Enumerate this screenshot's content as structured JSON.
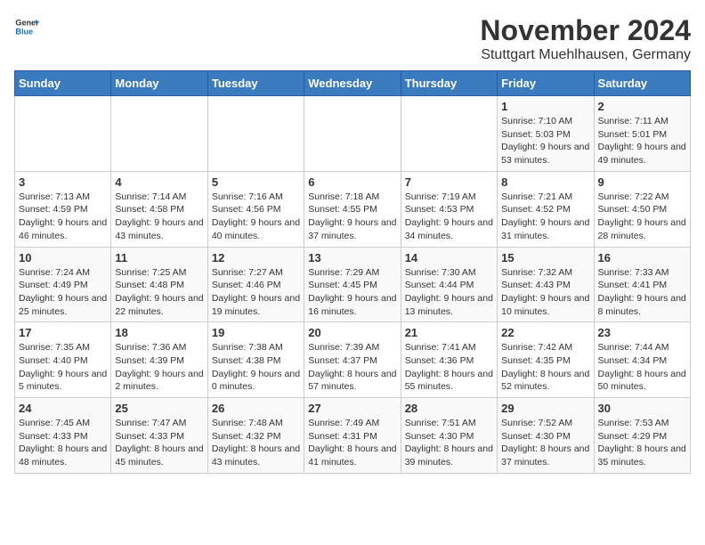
{
  "header": {
    "logo_general": "General",
    "logo_blue": "Blue",
    "month": "November 2024",
    "location": "Stuttgart Muehlhausen, Germany"
  },
  "days_of_week": [
    "Sunday",
    "Monday",
    "Tuesday",
    "Wednesday",
    "Thursday",
    "Friday",
    "Saturday"
  ],
  "weeks": [
    [
      {
        "day": "",
        "info": ""
      },
      {
        "day": "",
        "info": ""
      },
      {
        "day": "",
        "info": ""
      },
      {
        "day": "",
        "info": ""
      },
      {
        "day": "",
        "info": ""
      },
      {
        "day": "1",
        "info": "Sunrise: 7:10 AM\nSunset: 5:03 PM\nDaylight: 9 hours and 53 minutes."
      },
      {
        "day": "2",
        "info": "Sunrise: 7:11 AM\nSunset: 5:01 PM\nDaylight: 9 hours and 49 minutes."
      }
    ],
    [
      {
        "day": "3",
        "info": "Sunrise: 7:13 AM\nSunset: 4:59 PM\nDaylight: 9 hours and 46 minutes."
      },
      {
        "day": "4",
        "info": "Sunrise: 7:14 AM\nSunset: 4:58 PM\nDaylight: 9 hours and 43 minutes."
      },
      {
        "day": "5",
        "info": "Sunrise: 7:16 AM\nSunset: 4:56 PM\nDaylight: 9 hours and 40 minutes."
      },
      {
        "day": "6",
        "info": "Sunrise: 7:18 AM\nSunset: 4:55 PM\nDaylight: 9 hours and 37 minutes."
      },
      {
        "day": "7",
        "info": "Sunrise: 7:19 AM\nSunset: 4:53 PM\nDaylight: 9 hours and 34 minutes."
      },
      {
        "day": "8",
        "info": "Sunrise: 7:21 AM\nSunset: 4:52 PM\nDaylight: 9 hours and 31 minutes."
      },
      {
        "day": "9",
        "info": "Sunrise: 7:22 AM\nSunset: 4:50 PM\nDaylight: 9 hours and 28 minutes."
      }
    ],
    [
      {
        "day": "10",
        "info": "Sunrise: 7:24 AM\nSunset: 4:49 PM\nDaylight: 9 hours and 25 minutes."
      },
      {
        "day": "11",
        "info": "Sunrise: 7:25 AM\nSunset: 4:48 PM\nDaylight: 9 hours and 22 minutes."
      },
      {
        "day": "12",
        "info": "Sunrise: 7:27 AM\nSunset: 4:46 PM\nDaylight: 9 hours and 19 minutes."
      },
      {
        "day": "13",
        "info": "Sunrise: 7:29 AM\nSunset: 4:45 PM\nDaylight: 9 hours and 16 minutes."
      },
      {
        "day": "14",
        "info": "Sunrise: 7:30 AM\nSunset: 4:44 PM\nDaylight: 9 hours and 13 minutes."
      },
      {
        "day": "15",
        "info": "Sunrise: 7:32 AM\nSunset: 4:43 PM\nDaylight: 9 hours and 10 minutes."
      },
      {
        "day": "16",
        "info": "Sunrise: 7:33 AM\nSunset: 4:41 PM\nDaylight: 9 hours and 8 minutes."
      }
    ],
    [
      {
        "day": "17",
        "info": "Sunrise: 7:35 AM\nSunset: 4:40 PM\nDaylight: 9 hours and 5 minutes."
      },
      {
        "day": "18",
        "info": "Sunrise: 7:36 AM\nSunset: 4:39 PM\nDaylight: 9 hours and 2 minutes."
      },
      {
        "day": "19",
        "info": "Sunrise: 7:38 AM\nSunset: 4:38 PM\nDaylight: 9 hours and 0 minutes."
      },
      {
        "day": "20",
        "info": "Sunrise: 7:39 AM\nSunset: 4:37 PM\nDaylight: 8 hours and 57 minutes."
      },
      {
        "day": "21",
        "info": "Sunrise: 7:41 AM\nSunset: 4:36 PM\nDaylight: 8 hours and 55 minutes."
      },
      {
        "day": "22",
        "info": "Sunrise: 7:42 AM\nSunset: 4:35 PM\nDaylight: 8 hours and 52 minutes."
      },
      {
        "day": "23",
        "info": "Sunrise: 7:44 AM\nSunset: 4:34 PM\nDaylight: 8 hours and 50 minutes."
      }
    ],
    [
      {
        "day": "24",
        "info": "Sunrise: 7:45 AM\nSunset: 4:33 PM\nDaylight: 8 hours and 48 minutes."
      },
      {
        "day": "25",
        "info": "Sunrise: 7:47 AM\nSunset: 4:33 PM\nDaylight: 8 hours and 45 minutes."
      },
      {
        "day": "26",
        "info": "Sunrise: 7:48 AM\nSunset: 4:32 PM\nDaylight: 8 hours and 43 minutes."
      },
      {
        "day": "27",
        "info": "Sunrise: 7:49 AM\nSunset: 4:31 PM\nDaylight: 8 hours and 41 minutes."
      },
      {
        "day": "28",
        "info": "Sunrise: 7:51 AM\nSunset: 4:30 PM\nDaylight: 8 hours and 39 minutes."
      },
      {
        "day": "29",
        "info": "Sunrise: 7:52 AM\nSunset: 4:30 PM\nDaylight: 8 hours and 37 minutes."
      },
      {
        "day": "30",
        "info": "Sunrise: 7:53 AM\nSunset: 4:29 PM\nDaylight: 8 hours and 35 minutes."
      }
    ]
  ]
}
